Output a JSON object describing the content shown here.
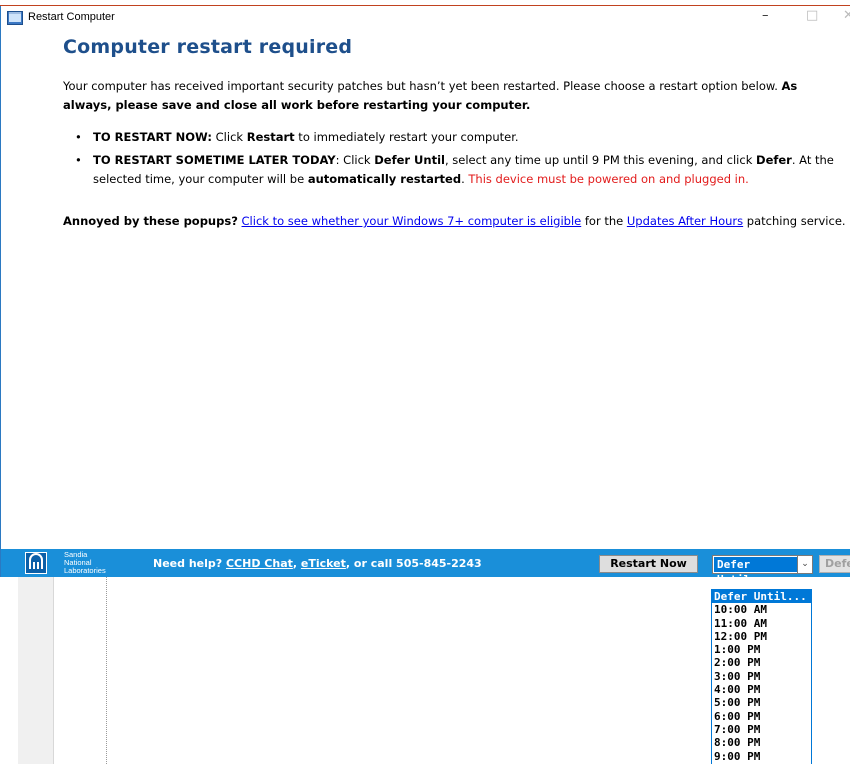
{
  "window": {
    "title": "Restart Computer",
    "controls": {
      "minimize": "–",
      "maximize": "□",
      "close": "✕"
    }
  },
  "content": {
    "heading": "Computer restart required",
    "intro_plain": "Your computer has received important security patches but hasn’t yet been restarted. Please choose a restart option below. ",
    "intro_bold": "As always, please save and close all work before restarting your computer.",
    "bullet1": {
      "lead": "TO RESTART NOW:",
      "t1": " Click ",
      "b1": "Restart",
      "t2": " to immediately restart your computer."
    },
    "bullet2": {
      "lead": "TO RESTART SOMETIME LATER TODAY",
      "t0": ": Click ",
      "b1": "Defer Until",
      "t1": ",  select any time up until 9 PM this evening, and click ",
      "b2": "Defer",
      "t2": ". At the selected time, your computer will be ",
      "b3": "automatically restarted",
      "t3": ". ",
      "red": "This device must be powered on and plugged in."
    },
    "annoyed": {
      "lead": "Annoyed by these popups?",
      "link1": "Click to see whether your Windows 7+ computer is eligible",
      "mid": " for the ",
      "link2": "Updates After Hours",
      "tail": " patching service."
    }
  },
  "footer": {
    "logo_lines": [
      "Sandia",
      "National",
      "Laboratories"
    ],
    "help_prefix": "Need help? ",
    "help_link1": "CCHD Chat",
    "help_sep": ", ",
    "help_link2": "eTicket",
    "help_suffix": ", or call 505-845-2243",
    "restart_label": "Restart Now",
    "select_value": "Defer Until...",
    "defer_label": "Defer"
  },
  "dropdown": {
    "options": [
      "Defer Until...",
      "10:00 AM",
      "11:00 AM",
      "12:00 PM",
      "1:00 PM",
      "2:00 PM",
      "3:00 PM",
      "4:00 PM",
      "5:00 PM",
      "6:00 PM",
      "7:00 PM",
      "8:00 PM",
      "9:00 PM"
    ]
  },
  "colors": {
    "heading": "#1e4f8b",
    "footer": "#1a8fd9",
    "accent": "#0078d7",
    "warning": "#e21b1b"
  },
  "icons": {
    "app": "monitor-window-icon",
    "logo": "sandia-logo-icon"
  }
}
